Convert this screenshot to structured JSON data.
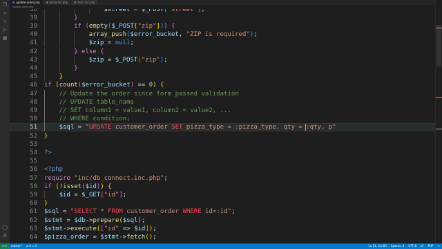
{
  "tabs": [
    {
      "label": "update-order.php",
      "active": true
    },
    {
      "label": "pizza-list.php",
      "active": false
    },
    {
      "label": "form.inc.php",
      "active": false
    }
  ],
  "breadcrumb": "update-order.php",
  "editor": {
    "lines": [
      {
        "n": "38",
        "indent": 4,
        "tokens": [
          [
            "var",
            "$street"
          ],
          [
            "op",
            " = "
          ],
          [
            "var",
            "$_POST"
          ],
          [
            "b3",
            "["
          ],
          [
            "str",
            "\"street\""
          ],
          [
            "b3",
            "]"
          ],
          [
            "op",
            ";"
          ]
        ]
      },
      {
        "n": "39",
        "indent": 2,
        "tokens": [
          [
            "b2",
            "}"
          ]
        ]
      },
      {
        "n": "39",
        "indent": 2,
        "tokens": [
          [
            "kw",
            "if"
          ],
          [
            "op",
            " "
          ],
          [
            "b2",
            "("
          ],
          [
            "fn",
            "empty"
          ],
          [
            "b3",
            "("
          ],
          [
            "var",
            "$_POST"
          ],
          [
            "b1",
            "["
          ],
          [
            "str",
            "\"zip\""
          ],
          [
            "b1",
            "]"
          ],
          [
            "b3",
            ")"
          ],
          [
            "b2",
            ")"
          ],
          [
            "op",
            " "
          ],
          [
            "b2",
            "{"
          ]
        ]
      },
      {
        "n": "40",
        "indent": 3,
        "tokens": [
          [
            "fn",
            "array_push"
          ],
          [
            "b3",
            "("
          ],
          [
            "var",
            "$error_bucket"
          ],
          [
            "op",
            ", "
          ],
          [
            "str",
            "\"ZIP is required\""
          ],
          [
            "b3",
            ")"
          ],
          [
            "op",
            ";"
          ]
        ]
      },
      {
        "n": "41",
        "indent": 3,
        "tokens": [
          [
            "var",
            "$zip"
          ],
          [
            "op",
            " = "
          ],
          [
            "tag",
            "null"
          ],
          [
            "op",
            ";"
          ]
        ]
      },
      {
        "n": "42",
        "indent": 2,
        "tokens": [
          [
            "b2",
            "}"
          ],
          [
            "op",
            " "
          ],
          [
            "kw",
            "else"
          ],
          [
            "op",
            " "
          ],
          [
            "b2",
            "{"
          ]
        ]
      },
      {
        "n": "43",
        "indent": 3,
        "tokens": [
          [
            "var",
            "$zip"
          ],
          [
            "op",
            " = "
          ],
          [
            "var",
            "$_POST"
          ],
          [
            "b3",
            "["
          ],
          [
            "str",
            "\"zip\""
          ],
          [
            "b3",
            "]"
          ],
          [
            "op",
            ";"
          ]
        ]
      },
      {
        "n": "44",
        "indent": 2,
        "tokens": [
          [
            "b2",
            "}"
          ]
        ]
      },
      {
        "n": "45",
        "indent": 1,
        "tokens": [
          [
            "b1",
            "}"
          ]
        ]
      },
      {
        "n": "46",
        "indent": 0,
        "tokens": [
          [
            "kw",
            "if"
          ],
          [
            "op",
            " "
          ],
          [
            "b1",
            "("
          ],
          [
            "fn",
            "count"
          ],
          [
            "b2",
            "("
          ],
          [
            "var",
            "$error_bucket"
          ],
          [
            "b2",
            ")"
          ],
          [
            "op",
            " == "
          ],
          [
            "num",
            "0"
          ],
          [
            "b1",
            ")"
          ],
          [
            "op",
            " "
          ],
          [
            "b1",
            "{"
          ]
        ]
      },
      {
        "n": "47",
        "indent": 1,
        "tokens": [
          [
            "cm",
            "// Update the order since form passed validation"
          ]
        ]
      },
      {
        "n": "48",
        "indent": 1,
        "tokens": [
          [
            "cm",
            "// UPDATE table_name"
          ]
        ]
      },
      {
        "n": "49",
        "indent": 1,
        "tokens": [
          [
            "cm",
            "// SET column1 = value1, column2 = value2, ..."
          ]
        ]
      },
      {
        "n": "50",
        "indent": 1,
        "tokens": [
          [
            "cm",
            "// WHERE condition;"
          ]
        ]
      },
      {
        "n": "51",
        "indent": 1,
        "current": true,
        "tokens": [
          [
            "var",
            "$sql"
          ],
          [
            "op",
            " = "
          ],
          [
            "str",
            "\""
          ],
          [
            "sql",
            "UPDATE"
          ],
          [
            "str",
            " customer_order "
          ],
          [
            "sql",
            "SET"
          ],
          [
            "str",
            " pizza_type = :pizza_type, qty = :qty, p\""
          ]
        ]
      },
      {
        "n": "52",
        "indent": 0,
        "tokens": [
          [
            "b1",
            "}"
          ]
        ]
      },
      {
        "n": "53",
        "indent": 0,
        "tokens": []
      },
      {
        "n": "54",
        "indent": 0,
        "tokens": [
          [
            "tag",
            "?>"
          ]
        ]
      },
      {
        "n": "55",
        "indent": 0,
        "tokens": []
      },
      {
        "n": "56",
        "indent": 0,
        "tokens": [
          [
            "tag",
            "<?php"
          ]
        ]
      },
      {
        "n": "57",
        "indent": 0,
        "tokens": [
          [
            "kw",
            "require"
          ],
          [
            "op",
            " "
          ],
          [
            "str",
            "\"inc/db_connect.inc.php\""
          ],
          [
            "op",
            ";"
          ]
        ]
      },
      {
        "n": "58",
        "indent": 0,
        "tokens": [
          [
            "kw",
            "if"
          ],
          [
            "op",
            " "
          ],
          [
            "b1",
            "("
          ],
          [
            "op",
            "!"
          ],
          [
            "fn",
            "isset"
          ],
          [
            "b2",
            "("
          ],
          [
            "var",
            "$id"
          ],
          [
            "b2",
            ")"
          ],
          [
            "b1",
            ")"
          ],
          [
            "op",
            " "
          ],
          [
            "b1",
            "{"
          ]
        ]
      },
      {
        "n": "59",
        "indent": 1,
        "tokens": [
          [
            "var",
            "$id"
          ],
          [
            "op",
            " = "
          ],
          [
            "var",
            "$_GET"
          ],
          [
            "b2",
            "["
          ],
          [
            "str",
            "\"id\""
          ],
          [
            "b2",
            "]"
          ],
          [
            "op",
            ";"
          ]
        ]
      },
      {
        "n": "60",
        "indent": 0,
        "tokens": [
          [
            "b1",
            "}"
          ]
        ]
      },
      {
        "n": "61",
        "indent": 0,
        "tokens": [
          [
            "var",
            "$sql"
          ],
          [
            "op",
            " = "
          ],
          [
            "str",
            "\""
          ],
          [
            "sql",
            "SELECT"
          ],
          [
            "str",
            " * "
          ],
          [
            "sql",
            "FROM"
          ],
          [
            "str",
            " customer_order "
          ],
          [
            "sql",
            "WHERE"
          ],
          [
            "str",
            " id=:id\""
          ],
          [
            "op",
            ";"
          ]
        ]
      },
      {
        "n": "62",
        "indent": 0,
        "tokens": [
          [
            "var",
            "$stmt"
          ],
          [
            "op",
            " = "
          ],
          [
            "var",
            "$db"
          ],
          [
            "op",
            "->"
          ],
          [
            "fn",
            "prepare"
          ],
          [
            "b1",
            "("
          ],
          [
            "var",
            "$sql"
          ],
          [
            "b1",
            ")"
          ],
          [
            "op",
            ";"
          ]
        ]
      },
      {
        "n": "63",
        "indent": 0,
        "tokens": [
          [
            "var",
            "$stmt"
          ],
          [
            "op",
            "->"
          ],
          [
            "fn",
            "execute"
          ],
          [
            "b1",
            "("
          ],
          [
            "b2",
            "["
          ],
          [
            "str",
            "\"id\""
          ],
          [
            "op",
            " => "
          ],
          [
            "var",
            "$id"
          ],
          [
            "b2",
            "]"
          ],
          [
            "b1",
            ")"
          ],
          [
            "op",
            ";"
          ]
        ]
      },
      {
        "n": "64",
        "indent": 0,
        "tokens": [
          [
            "var",
            "$pizza_order"
          ],
          [
            "op",
            " = "
          ],
          [
            "var",
            "$stmt"
          ],
          [
            "op",
            "->"
          ],
          [
            "fn",
            "fetch"
          ],
          [
            "b1",
            "("
          ],
          [
            "b1",
            ")"
          ],
          [
            "op",
            ";"
          ]
        ]
      }
    ]
  },
  "statusbar": {
    "remote": "><",
    "branch": "master*",
    "problems": "⊗ 0 ⚠ 0",
    "position": "Ln 51, Col 83",
    "spaces": "Spaces: 4",
    "encoding": "UTF-8",
    "eol": "LF",
    "language": "PHP",
    "extra": "⚇"
  },
  "colors": {
    "statusbar": "#007acc",
    "background": "#1e1e1e",
    "keyword": "#c586c0",
    "string": "#ce9178",
    "variable": "#9cdcfe",
    "comment": "#6a9955"
  }
}
